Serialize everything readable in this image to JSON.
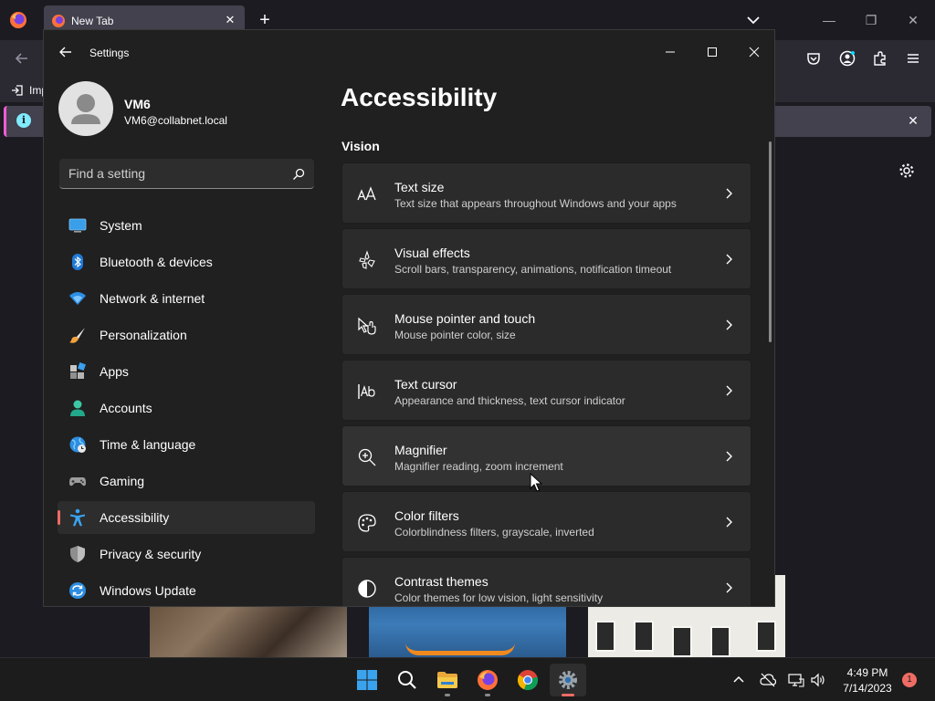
{
  "firefox": {
    "tab_title": "New Tab",
    "tab_close": "✕",
    "new_tab": "+",
    "bookmark_label": "Imp",
    "notice_icon": "i",
    "notice_close": "✕",
    "window_min": "—",
    "window_restore": "❐",
    "window_close": "✕"
  },
  "settings": {
    "app_title": "Settings",
    "profile": {
      "name": "VM6",
      "email": "VM6@collabnet.local"
    },
    "search": {
      "placeholder": "Find a setting"
    },
    "nav": [
      {
        "label": "System",
        "icon": "system-icon"
      },
      {
        "label": "Bluetooth & devices",
        "icon": "bluetooth-icon"
      },
      {
        "label": "Network & internet",
        "icon": "network-icon"
      },
      {
        "label": "Personalization",
        "icon": "personalization-icon"
      },
      {
        "label": "Apps",
        "icon": "apps-icon"
      },
      {
        "label": "Accounts",
        "icon": "accounts-icon"
      },
      {
        "label": "Time & language",
        "icon": "time-language-icon"
      },
      {
        "label": "Gaming",
        "icon": "gaming-icon"
      },
      {
        "label": "Accessibility",
        "icon": "accessibility-icon",
        "active": true
      },
      {
        "label": "Privacy & security",
        "icon": "privacy-icon"
      },
      {
        "label": "Windows Update",
        "icon": "windows-update-icon"
      }
    ],
    "page_title": "Accessibility",
    "section": "Vision",
    "cards": [
      {
        "title": "Text size",
        "subtitle": "Text size that appears throughout Windows and your apps",
        "icon": "text-size-icon"
      },
      {
        "title": "Visual effects",
        "subtitle": "Scroll bars, transparency, animations, notification timeout",
        "icon": "visual-effects-icon"
      },
      {
        "title": "Mouse pointer and touch",
        "subtitle": "Mouse pointer color, size",
        "icon": "mouse-pointer-icon"
      },
      {
        "title": "Text cursor",
        "subtitle": "Appearance and thickness, text cursor indicator",
        "icon": "text-cursor-icon"
      },
      {
        "title": "Magnifier",
        "subtitle": "Magnifier reading, zoom increment",
        "icon": "magnifier-icon"
      },
      {
        "title": "Color filters",
        "subtitle": "Colorblindness filters, grayscale, inverted",
        "icon": "color-filters-icon"
      },
      {
        "title": "Contrast themes",
        "subtitle": "Color themes for low vision, light sensitivity",
        "icon": "contrast-icon"
      }
    ]
  },
  "taskbar": {
    "time": "4:49 PM",
    "date": "7/14/2023",
    "notification_count": "1"
  },
  "colors": {
    "accent": "#ee6c64",
    "settings_bg": "#202020",
    "card_bg": "#2b2b2b",
    "firefox_bg": "#1c1b22"
  }
}
